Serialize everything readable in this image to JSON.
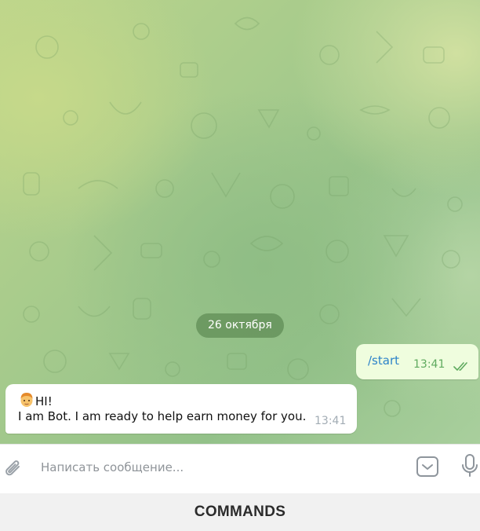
{
  "chat": {
    "date_separator": "26 октября",
    "messages": [
      {
        "direction": "outgoing",
        "text": "/start",
        "time": "13:41",
        "status": "read"
      },
      {
        "direction": "incoming",
        "emoji": "man-emoji",
        "line1": "HI!",
        "line2": "I am Bot. I am ready to help earn money for you.",
        "time": "13:41"
      }
    ]
  },
  "composer": {
    "placeholder": "Написать сообщение...",
    "icons": [
      "paperclip-icon",
      "keyboard-toggle-icon",
      "microphone-icon"
    ]
  },
  "keyboard": {
    "button_label": "COMMANDS"
  },
  "colors": {
    "outgoing_bubble": "#effdde",
    "command_link": "#2d83c9",
    "read_checks": "#5faa5f",
    "incoming_time": "#a2acb4"
  }
}
